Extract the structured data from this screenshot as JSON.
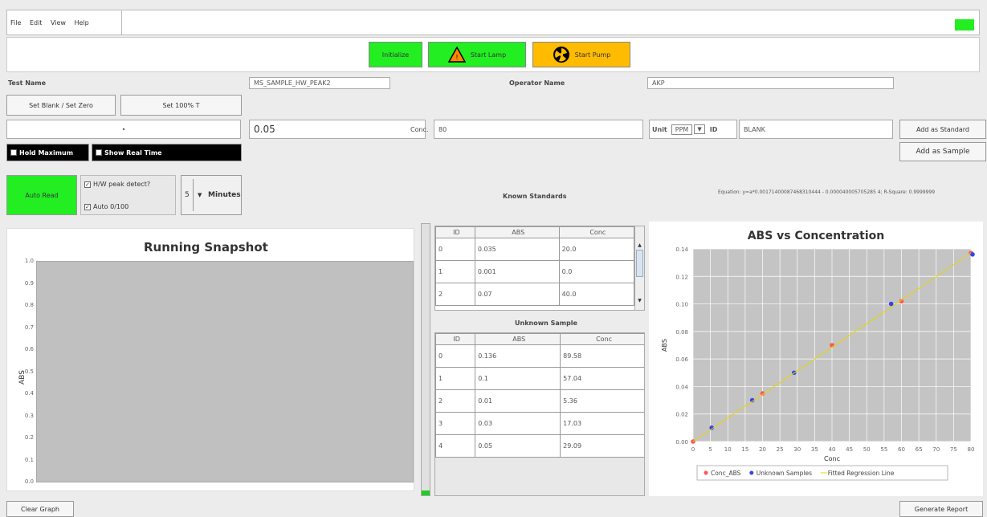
{
  "menu": {
    "items": [
      "File",
      "Edit",
      "View",
      "Help"
    ]
  },
  "toolbar": {
    "initialize": "Initialize",
    "start_lamp": "Start Lamp",
    "start_pump": "Start Pump"
  },
  "form": {
    "test_name_label": "Test Name",
    "test_name_value": "MS_SAMPLE_HW_PEAK2",
    "operator_label": "Operator Name",
    "operator_value": "AKP",
    "set_blank": "Set Blank / Set Zero",
    "set_100": "Set 100% T",
    "dropdown_marker": "•",
    "abs_value": "0.05",
    "conc_label": "Conc.",
    "conc_value": "80",
    "unit_label": "Unit",
    "unit_value": "PPM",
    "id_label": "ID",
    "id_value": "BLANK",
    "add_standard": "Add as Standard",
    "add_sample": "Add as Sample",
    "hold_max": "Hold Maximum",
    "show_real_time": "Show Real Time",
    "auto_read": "Auto Read",
    "hw_peak": "H/W peak detect?",
    "auto_0_100": "Auto 0/100",
    "minutes_value": "5",
    "minutes_label": "Minutes"
  },
  "equation_text": "Equation: y=a*0.00171400087468310444 - 0.000040005705285 4; R-Square: 0.9999999",
  "known": {
    "title": "Known Standards",
    "headers": [
      "ID",
      "ABS",
      "Conc"
    ],
    "rows": [
      [
        "0",
        "0.035",
        "20.0"
      ],
      [
        "1",
        "0.001",
        "0.0"
      ],
      [
        "2",
        "0.07",
        "40.0"
      ]
    ]
  },
  "unknown": {
    "title": "Unknown Sample",
    "headers": [
      "ID",
      "ABS",
      "Conc"
    ],
    "rows": [
      [
        "0",
        "0.136",
        "89.58"
      ],
      [
        "1",
        "0.1",
        "57.04"
      ],
      [
        "2",
        "0.01",
        "5.36"
      ],
      [
        "3",
        "0.03",
        "17.03"
      ],
      [
        "4",
        "0.05",
        "29.09"
      ]
    ]
  },
  "snapshot": {
    "title": "Running Snapshot",
    "ylabel": "ABS",
    "yticks": [
      "1.0",
      "0.9",
      "0.8",
      "0.7",
      "0.6",
      "0.5",
      "0.4",
      "0.3",
      "0.2",
      "0.1",
      "0.0"
    ]
  },
  "chart_data": {
    "type": "scatter",
    "title": "ABS vs Concentration",
    "xlabel": "Conc",
    "ylabel": "ABS",
    "xlim": [
      0,
      80
    ],
    "ylim": [
      0,
      0.14
    ],
    "xticks": [
      "0",
      "5",
      "10",
      "15",
      "20",
      "25",
      "30",
      "35",
      "40",
      "45",
      "50",
      "55",
      "60",
      "65",
      "70",
      "75",
      "80"
    ],
    "yticks": [
      "0.00",
      "0.02",
      "0.04",
      "0.06",
      "0.08",
      "0.10",
      "0.12",
      "0.14"
    ],
    "series": [
      {
        "name": "Conc_ABS",
        "color": "#ff5555",
        "x": [
          0,
          20,
          40,
          60,
          80
        ],
        "y": [
          0,
          0.035,
          0.07,
          0.102,
          0.137
        ]
      },
      {
        "name": "Unknown Samples",
        "color": "#3344ee",
        "x": [
          5.36,
          17.03,
          29.09,
          57.04,
          89.58
        ],
        "y": [
          0.01,
          0.03,
          0.05,
          0.1,
          0.136
        ]
      },
      {
        "name": "Fitted Regression Line",
        "color": "#e8d400",
        "type": "line",
        "x": [
          0,
          80
        ],
        "y": [
          0,
          0.137
        ]
      }
    ],
    "grid": true,
    "legend": "bottom"
  },
  "bottom": {
    "clear": "Clear Graph",
    "generate": "Generate Report"
  },
  "colors": {
    "green": "#22ee22",
    "orange": "#ffbb00",
    "black": "#000000"
  }
}
